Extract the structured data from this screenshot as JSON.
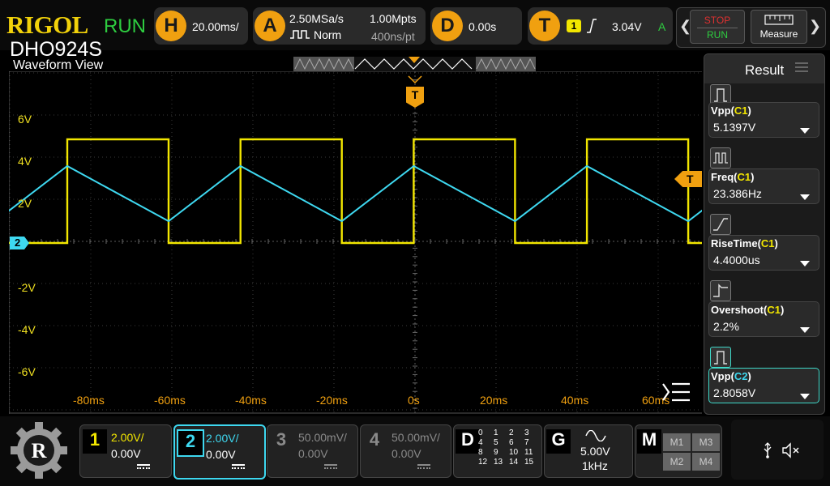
{
  "brand": "RIGOL",
  "run_state": "RUN",
  "model": "DHO924S",
  "horizontal": {
    "key": "H",
    "timebase": "20.00ms/"
  },
  "acquire": {
    "key": "A",
    "sample_rate": "2.50MSa/s",
    "memory_depth": "1.00Mpts",
    "mode": "Norm",
    "sample_interval": "400ns/pt"
  },
  "delay": {
    "key": "D",
    "value": "0.00s"
  },
  "trigger": {
    "key": "T",
    "source": "1",
    "level": "3.04V",
    "sweep": "A"
  },
  "stop_run": {
    "stop": "STOP",
    "run": "RUN"
  },
  "measure_label": "Measure",
  "view_title": "Waveform View",
  "y_labels": [
    "6V",
    "4V",
    "2V",
    "-2V",
    "-4V",
    "-6V"
  ],
  "x_labels": [
    "-80ms",
    "-60ms",
    "-40ms",
    "-20ms",
    "0s",
    "20ms",
    "40ms",
    "60ms"
  ],
  "channel_marker": "2",
  "trigger_marker": "T",
  "result_title": "Result",
  "measurements": [
    {
      "name": "Vpp",
      "src": "C1",
      "value": "5.1397V",
      "icon": "vpp-icon"
    },
    {
      "name": "Freq",
      "src": "C1",
      "value": "23.386Hz",
      "icon": "freq-icon"
    },
    {
      "name": "RiseTime",
      "src": "C1",
      "value": "4.4000us",
      "icon": "risetime-icon"
    },
    {
      "name": "Overshoot",
      "src": "C1",
      "value": "2.2%",
      "icon": "overshoot-icon"
    },
    {
      "name": "Vpp",
      "src": "C2",
      "value": "2.8058V",
      "icon": "vpp-icon"
    }
  ],
  "channels": [
    {
      "num": "1",
      "scale": "2.00V/",
      "offset": "0.00V",
      "color": "#f2e600",
      "active": true
    },
    {
      "num": "2",
      "scale": "2.00V/",
      "offset": "0.00V",
      "color": "#3ed8f0",
      "active": true
    },
    {
      "num": "3",
      "scale": "50.00mV/",
      "offset": "0.00V",
      "color": "#8a8a8a",
      "active": false
    },
    {
      "num": "4",
      "scale": "50.00mV/",
      "offset": "0.00V",
      "color": "#8a8a8a",
      "active": false
    }
  ],
  "digital": {
    "key": "D",
    "grid": [
      "0",
      "1",
      "2",
      "3",
      "4",
      "5",
      "6",
      "7",
      "8",
      "9",
      "10",
      "11",
      "12",
      "13",
      "14",
      "15"
    ]
  },
  "generator": {
    "key": "G",
    "amplitude": "5.00V",
    "frequency": "1kHz"
  },
  "math": {
    "key": "M",
    "items": [
      "M1",
      "M3",
      "M2",
      "M4"
    ]
  },
  "colors": {
    "ch1": "#f2e600",
    "ch2": "#3ed8f0",
    "accent": "#f0a010",
    "run": "#2ecc40"
  }
}
